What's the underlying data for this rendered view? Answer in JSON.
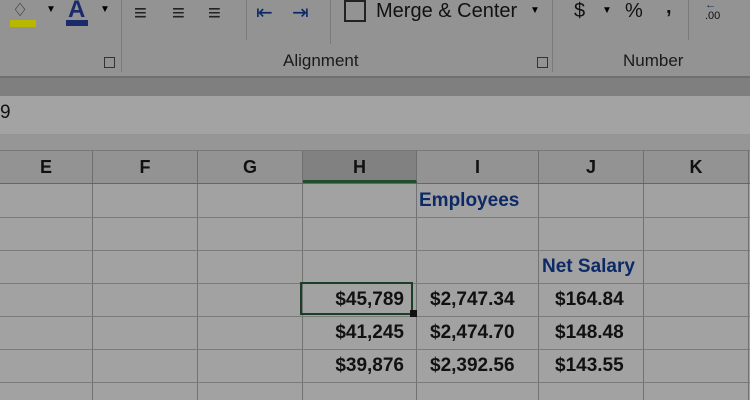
{
  "ribbon": {
    "fill_color_label": "",
    "font_color_label": "A",
    "merge_center_label": "Merge & Center",
    "currency_symbol": "$",
    "percent_symbol": "%",
    "comma_symbol": ",",
    "decimal_label": ".00",
    "groups": [
      "Alignment",
      "Number"
    ]
  },
  "formula_bar": {
    "name_box_value": "9"
  },
  "columns": [
    "E",
    "F",
    "G",
    "H",
    "I",
    "J",
    "K"
  ],
  "selected_column": "H",
  "cells": {
    "I_title": "Employees",
    "J_header": "Net Salary",
    "rows": [
      [
        "$45,789",
        "$2,747.34",
        "$164.84"
      ],
      [
        "$41,245",
        "$2,474.70",
        "$148.48"
      ],
      [
        "$39,876",
        "$2,392.56",
        "$143.55"
      ]
    ]
  },
  "colors": {
    "selection": "#1c3d26",
    "header_text": "#0d2a66",
    "fill_highlight": "#b8b800",
    "font_underline": "#1a2a6a"
  }
}
